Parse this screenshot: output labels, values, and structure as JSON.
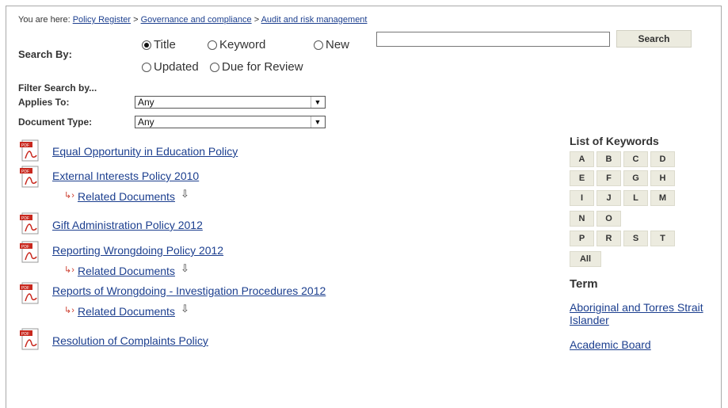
{
  "breadcrumb": {
    "prefix": "You are here: ",
    "items": [
      "Policy Register",
      "Governance and compliance",
      "Audit and risk management"
    ],
    "separator": " > "
  },
  "search": {
    "label": "Search By:",
    "options": [
      {
        "label": "Title",
        "selected": true
      },
      {
        "label": "Keyword",
        "selected": false
      },
      {
        "label": "New",
        "selected": false
      },
      {
        "label": "Updated",
        "selected": false
      },
      {
        "label": "Due for Review",
        "selected": false
      }
    ],
    "input_value": "",
    "button_label": "Search"
  },
  "filters": {
    "heading": "Filter Search by...",
    "applies_to": {
      "label": "Applies To:",
      "value": "Any"
    },
    "document_type": {
      "label": "Document Type:",
      "value": "Any"
    }
  },
  "documents": [
    {
      "title": "Equal Opportunity in Education Policy",
      "related": null
    },
    {
      "title": "External Interests Policy 2010",
      "related": "Related Documents"
    },
    {
      "title": "Gift Administration Policy 2012",
      "related": null
    },
    {
      "title": "Reporting Wrongdoing Policy 2012",
      "related": "Related Documents"
    },
    {
      "title": "Reports of Wrongdoing - Investigation Procedures 2012",
      "related": "Related Documents"
    },
    {
      "title": "Resolution of Complaints Policy",
      "related": null
    }
  ],
  "keywords": {
    "title": "List of Keywords",
    "letters": [
      "A",
      "B",
      "C",
      "D",
      "E",
      "F",
      "G",
      "H",
      "I",
      "J",
      "L",
      "M",
      "N",
      "O",
      "P",
      "R",
      "S",
      "T",
      "All"
    ]
  },
  "terms": {
    "heading": "Term",
    "items": [
      "Aboriginal and Torres Strait Islander",
      "Academic Board"
    ]
  },
  "colors": {
    "link": "#1c3f8f",
    "button_bg": "#ecebdf",
    "pdf_red": "#c8281e"
  }
}
